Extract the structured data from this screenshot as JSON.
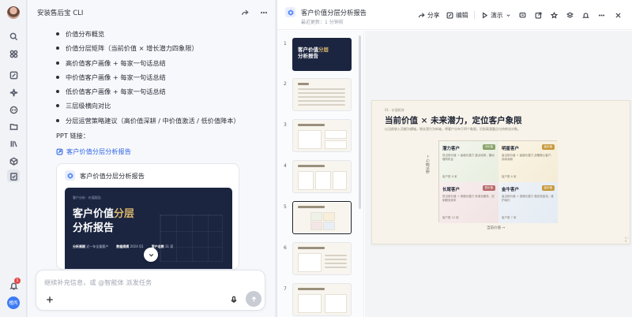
{
  "colors": {
    "accent": "#2f66e8",
    "navy": "#1b2540",
    "gold": "#d8b46a",
    "danger": "#e54848"
  },
  "rail": {
    "icons": [
      "search-icon",
      "grid-icon",
      "edit-icon",
      "spark-icon",
      "chat-icon",
      "folder-icon",
      "library-icon",
      "cube-icon",
      "clipboard-icon",
      "bell-icon"
    ],
    "notification_count": "1",
    "user_badge": "橙丙"
  },
  "chat": {
    "title": "安装售后宝 CLI",
    "bullets": [
      "价值分布概览",
      "价值分层矩阵（当前价值 × 增长潜力四象限）",
      "高价值客户画像 + 每家一句话总结",
      "中价值客户画像 + 每家一句话总结",
      "低价值客户画像 + 每家一句话总结",
      "三层级横向对比",
      "分层运营策略建议（高价值深耕 / 中价值激活 / 低价值降本）"
    ],
    "ppt_label": "PPT 链接：",
    "ppt_link": "客户价值分层分析报告",
    "card": {
      "title": "客户价值分层分析报告",
      "slide_eyebrow": "客户分析 · 价值报告",
      "slide_title_a": "客户价值",
      "slide_title_b": "分层",
      "slide_title_c": "分析报告",
      "meta": [
        {
          "k": "分析周期",
          "v": "近一年全量客户"
        },
        {
          "k": "数据规模",
          "v": "2024 Q1"
        },
        {
          "k": "客户总数",
          "v": "31 家"
        }
      ]
    },
    "input_placeholder": "继续补充信息，或 @智能体 派发任务"
  },
  "doc": {
    "title": "客户价值分层分析报告",
    "subtitle": "最近更新：1 分钟前",
    "toolbar": {
      "share": "分享",
      "edit": "编辑",
      "present": "演示"
    },
    "thumb_numbers": [
      "1",
      "2",
      "3",
      "4",
      "5",
      "6",
      "7"
    ],
    "thumb1_title_a": "客户价值",
    "thumb1_title_b": "分层",
    "thumb1_title_c": "分析报告",
    "slide": {
      "eyebrow": "01 · 价值矩阵",
      "title": "当前价值 × 未来潜力，定位客户象限",
      "desc": "以当前收入贡献为横轴，增长潜力为纵轴，将客户分布于四个象限，识别高潜重点与待转化对象。",
      "y_label": "增长潜力 →",
      "x_label": "当前价值 →",
      "quadrants": [
        {
          "name": "潜力客户",
          "tag": "中价值",
          "text": "低当前价值 + 高增长潜力\n重点培育，撬动增购机会",
          "stat": "客户数 8 家"
        },
        {
          "name": "明星客户",
          "tag": "高价值",
          "text": "高当前价值 + 高增长潜力\n战略核心客户，持续深耕",
          "stat": "客户数 6 家"
        },
        {
          "name": "长尾客户",
          "tag": "低价值",
          "text": "低当前价值 + 低增长潜力\n标准化服务，控制服务成本",
          "stat": "客户数 10 家"
        },
        {
          "name": "金牛客户",
          "tag": "高价值",
          "text": "高当前价值 + 低增长潜力\n稳定现金流，维护续约",
          "stat": "客户数 7 家"
        }
      ],
      "page": "5 / 9"
    }
  }
}
